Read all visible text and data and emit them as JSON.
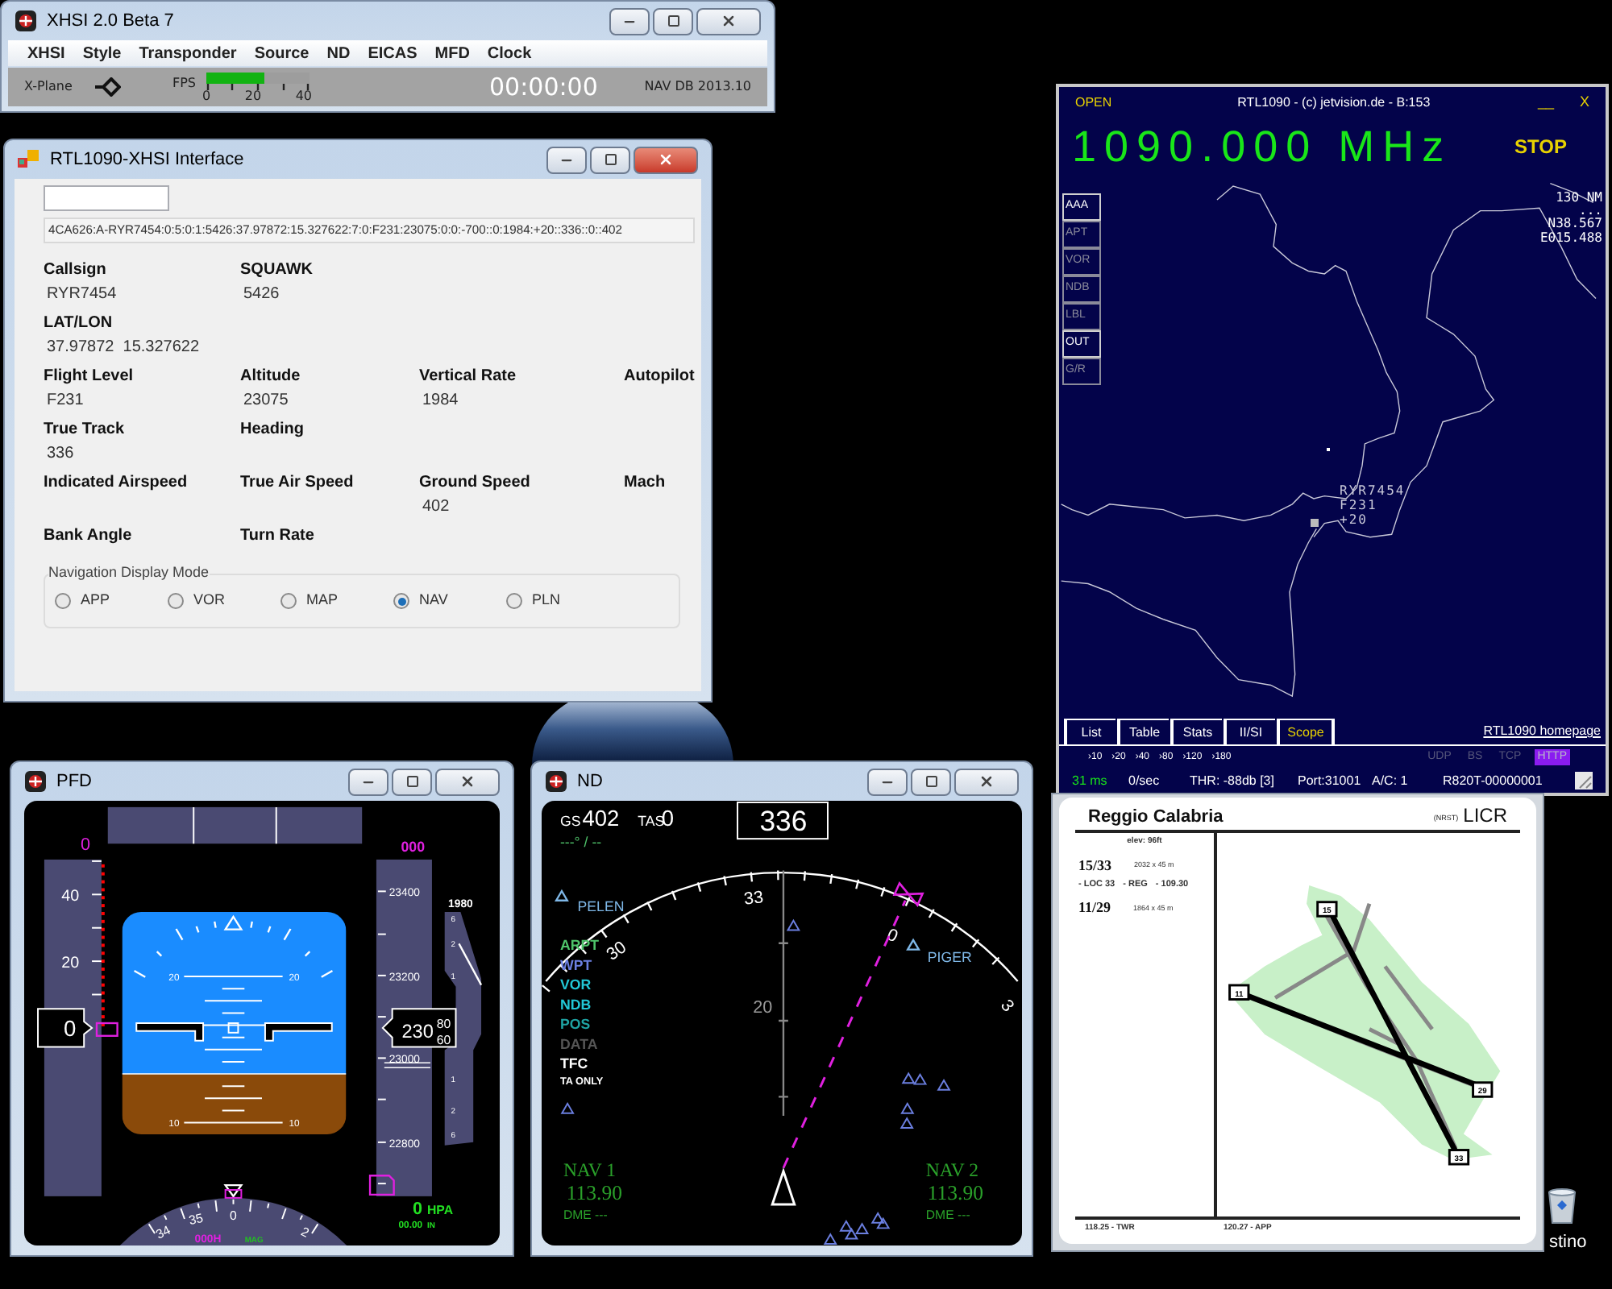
{
  "xhsi": {
    "title": "XHSI 2.0 Beta 7",
    "menu": [
      "XHSI",
      "Style",
      "Transponder",
      "Source",
      "ND",
      "EICAS",
      "MFD",
      "Clock"
    ],
    "status": {
      "source": "X-Plane",
      "fps_label": "FPS",
      "fps": {
        "level": 0.57
      },
      "fps_ticks": [
        "0",
        "20",
        "40"
      ],
      "clock": "00:00:00",
      "nav_db": "NAV DB 2013.10"
    }
  },
  "interface": {
    "title": "RTL1090-XHSI Interface",
    "raw": "4CA626:A-RYR7454:0:5:0:1:5426:37.97872:15.327622:7:0:F231:23075:0:0:-700::0:1984:+20::336::0::402",
    "rows": [
      [
        {
          "label": "Callsign",
          "value": "RYR7454"
        },
        {
          "label": "SQUAWK",
          "value": "5426"
        }
      ],
      [
        {
          "label": "LAT/LON",
          "value": "37.97872  15.327622"
        }
      ],
      [
        {
          "label": "Flight Level",
          "value": "F231"
        },
        {
          "label": "Altitude",
          "value": "23075"
        },
        {
          "label": "Vertical Rate",
          "value": "1984"
        },
        {
          "label": "Autopilot"
        }
      ],
      [
        {
          "label": "True Track",
          "value": "336"
        },
        {
          "label": "Heading"
        }
      ],
      [
        {
          "label": "Indicated Airspeed"
        },
        {
          "label": "True Air Speed"
        },
        {
          "label": "Ground Speed",
          "value": "402"
        },
        {
          "label": "Mach"
        }
      ],
      [
        {
          "label": "Bank Angle"
        },
        {
          "label": "Turn Rate"
        }
      ]
    ],
    "nav_mode": {
      "title": "Navigation Display Mode",
      "options": [
        {
          "label": "APP",
          "selected": false
        },
        {
          "label": "VOR",
          "selected": false
        },
        {
          "label": "MAP",
          "selected": false
        },
        {
          "label": "NAV",
          "selected": true
        },
        {
          "label": "PLN",
          "selected": false
        }
      ]
    }
  },
  "radar": {
    "open": "OPEN",
    "title": "RTL1090 - (c) jetvision.de - B:153",
    "minimize": "__",
    "close": "X",
    "frequency": "1090.000 MHz",
    "stop": "STOP",
    "layers": [
      {
        "label": "AAA",
        "on": true
      },
      {
        "label": "APT",
        "on": false
      },
      {
        "label": "VOR",
        "on": false
      },
      {
        "label": "NDB",
        "on": false
      },
      {
        "label": "LBL",
        "on": false
      },
      {
        "label": "OUT",
        "on": true
      },
      {
        "label": "G/R",
        "on": false
      }
    ],
    "range": "130 NM",
    "cursor": "...",
    "lat": "N38.567",
    "lon": "E015.488",
    "target": [
      "RYR7454",
      "F231",
      "+20"
    ],
    "tabs": [
      {
        "label": "List",
        "selected": false
      },
      {
        "label": "Table",
        "selected": false
      },
      {
        "label": "Stats",
        "selected": false
      },
      {
        "label": "II/SI",
        "selected": false
      },
      {
        "label": "Scope",
        "selected": true
      }
    ],
    "homepage": "RTL1090 homepage",
    "filters": [
      "›10",
      "›20",
      "›40",
      "›80",
      "›120",
      "›180"
    ],
    "protocols": [
      {
        "label": "UDP",
        "on": false
      },
      {
        "label": "BS",
        "on": false
      },
      {
        "label": "TCP",
        "on": false
      },
      {
        "label": "HTTP",
        "on": true
      }
    ],
    "latency": "31 ms",
    "rate": "0/sec",
    "threshold": "THR: -88db [3]",
    "port": "Port:31001",
    "aircraft": "A/C: 1",
    "device": "R820T-00000001"
  },
  "pfd": {
    "title": "PFD",
    "speed_target": "0",
    "speed_labels": [
      "40",
      "20"
    ],
    "speed": "0",
    "altitude_target": "000",
    "altitude_labels": [
      "23400",
      "23200",
      "23000",
      "22800"
    ],
    "altitude": "230",
    "altitude_rolling": [
      "80",
      "60"
    ],
    "vertical_speed": "1980",
    "vs_labels": [
      "6",
      "2",
      "1",
      "1",
      "2",
      "6"
    ],
    "pitch_labels": [
      "20",
      "20",
      "10",
      "10"
    ],
    "heading_labels": [
      "34",
      "35",
      "0",
      "2"
    ],
    "heading_select": "000H",
    "heading_ref": "MAG",
    "baro": "0",
    "baro_unit": "HPA",
    "baro_in": "00.00",
    "baro_in_unit": "IN"
  },
  "nd": {
    "title": "ND",
    "gs_label": "GS",
    "gs": "402",
    "tas_label": "TAS",
    "tas": "0",
    "track": "336",
    "wind": "---° / --",
    "compass_labels": [
      "33",
      "30",
      "0",
      "3"
    ],
    "range": "20",
    "waypoints": [
      "PELEN",
      "PIGER"
    ],
    "legend": [
      {
        "label": "ARPT",
        "color": "#4fc46a"
      },
      {
        "label": "WPT",
        "color": "#6b7fe0"
      },
      {
        "label": "VOR",
        "color": "#22c7d6"
      },
      {
        "label": "NDB",
        "color": "#22c7d6"
      },
      {
        "label": "POS",
        "color": "#1fa3a3"
      },
      {
        "label": "DATA",
        "color": "#555555"
      },
      {
        "label": "TFC",
        "color": "#ffffff"
      },
      {
        "label": "TA ONLY",
        "color": "#ffffff"
      }
    ],
    "radios": [
      {
        "name": "NAV 1",
        "frequency": "113.90",
        "dme": "DME ---"
      },
      {
        "name": "NAV 2",
        "frequency": "113.90",
        "dme": "DME ---"
      }
    ]
  },
  "chart": {
    "airport": "Reggio Calabria",
    "nrst": "(NRST)",
    "icao": "LICR",
    "elevation": "elev: 96ft",
    "runways": [
      {
        "name": "15/33",
        "size": "2032 x 45 m",
        "ils": [
          "- LOC 33",
          "- REG",
          "- 109.30"
        ]
      },
      {
        "name": "11/29",
        "size": "1864 x 45 m"
      }
    ],
    "runway_ends": [
      "15",
      "11",
      "29",
      "33"
    ],
    "frequencies": [
      "118.25 - TWR",
      "120.27 - APP"
    ]
  },
  "desktop": {
    "recycle_bin": "stino"
  }
}
